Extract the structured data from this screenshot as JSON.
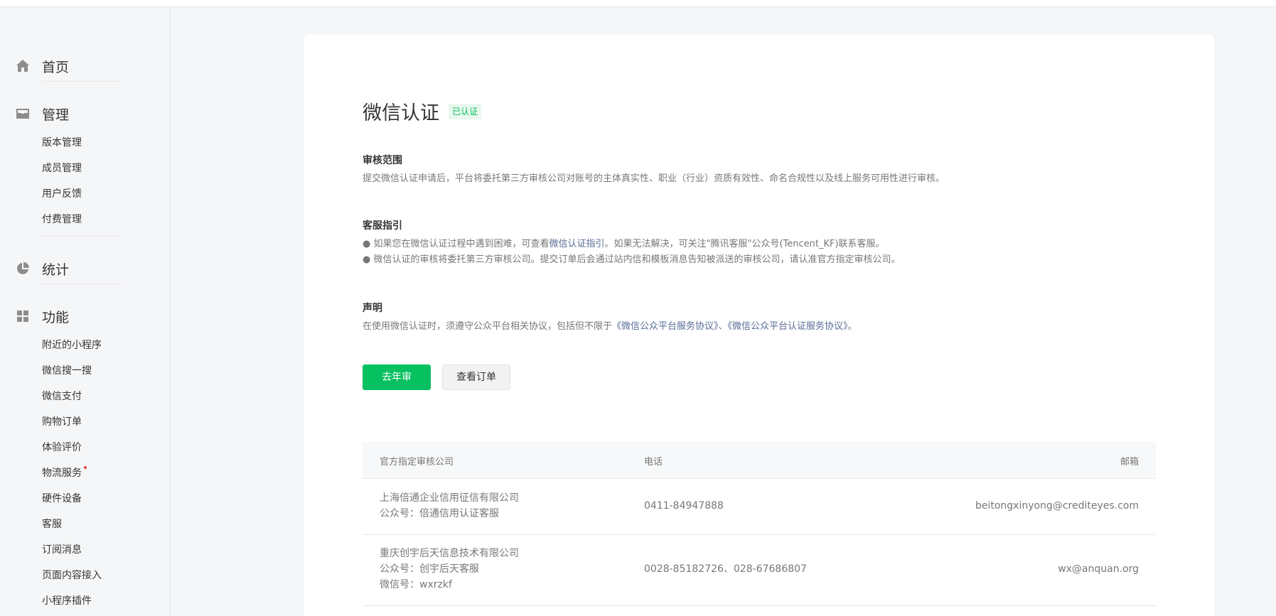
{
  "sidebar": {
    "home": {
      "label": "首页",
      "icon": "home-icon"
    },
    "manage": {
      "label": "管理",
      "icon": "inbox-icon",
      "items": [
        "版本管理",
        "成员管理",
        "用户反馈",
        "付费管理"
      ]
    },
    "stats": {
      "label": "统计",
      "icon": "pie-chart-icon"
    },
    "features": {
      "label": "功能",
      "icon": "grid-icon",
      "items": [
        "附近的小程序",
        "微信搜一搜",
        "微信支付",
        "购物订单",
        "体验评价",
        "物流服务",
        "硬件设备",
        "客服",
        "订阅消息",
        "页面内容接入",
        "小程序插件"
      ]
    }
  },
  "main": {
    "title": "微信认证",
    "badge": "已认证",
    "scope": {
      "title": "审核范围",
      "text": "提交微信认证申请后，平台将委托第三方审核公司对账号的主体真实性、职业（行业）资质有效性、命名合规性以及线上服务可用性进行审核。"
    },
    "service": {
      "title": "客服指引",
      "line1_prefix": "● 如果您在微信认证过程中遇到困难，可查看",
      "line1_link": "微信认证指引",
      "line1_suffix": "。如果无法解决，可关注\"腾讯客服\"公众号(Tencent_KF)联系客服。",
      "line2": "● 微信认证的审核将委托第三方审核公司。提交订单后会通过站内信和模板消息告知被派送的审核公司，请认准官方指定审核公司。"
    },
    "statement": {
      "title": "声明",
      "prefix": "在使用微信认证时，须遵守公众平台相关协议，包括但不限于",
      "link1": "《微信公众平台服务协议》",
      "sep": "、",
      "link2": "《微信公众平台认证服务协议》",
      "suffix": "。"
    },
    "buttons": {
      "primary": "去年审",
      "secondary": "查看订单"
    },
    "table": {
      "headers": [
        "官方指定审核公司",
        "电话",
        "邮箱"
      ],
      "rows": [
        {
          "company": "上海倍通企业信用征信有限公司",
          "account": "公众号：倍通信用认证客服",
          "wechat": "",
          "phone": "0411-84947888",
          "email": "beitongxinyong@crediteyes.com"
        },
        {
          "company": "重庆创宇后天信息技术有限公司",
          "account": "公众号：创宇后天客服",
          "wechat": "微信号：wxrzkf",
          "phone": "0028-85182726、028-67686807",
          "email": "wx@anquan.org"
        }
      ]
    }
  },
  "colors": {
    "accent": "#07c160",
    "link": "#576b95",
    "badge_bg": "#e9f8ef",
    "dot": "#e64340"
  }
}
